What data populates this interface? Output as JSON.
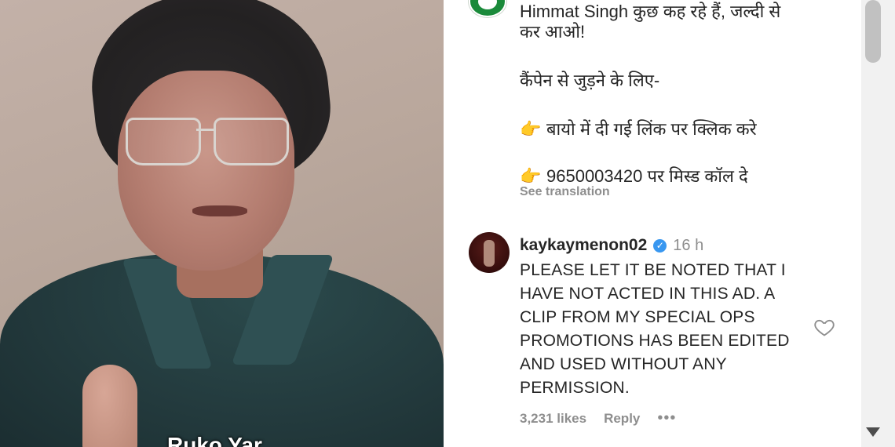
{
  "video": {
    "caption": "Ruko Yar"
  },
  "post": {
    "hindi_line1": "Himmat Singh कुछ कह रहे हैं, जल्दी से",
    "hindi_line2": "कर आओ!",
    "hindi_line3": "कैंपेन से जुड़ने के लिए-",
    "bullet1": "बायो में दी गई लिंक पर क्लिक करे",
    "bullet2": "9650003420 पर मिस्ड कॉल दे",
    "see_translation": "See translation"
  },
  "comment": {
    "username": "kaykaymenon02",
    "time": "16 h",
    "body": "PLEASE LET IT BE NOTED THAT I HAVE NOT ACTED IN THIS AD. A CLIP FROM MY SPECIAL OPS PROMOTIONS HAS BEEN EDITED AND USED WITHOUT ANY PERMISSION.",
    "likes": "3,231 likes",
    "reply": "Reply",
    "more": "•••"
  },
  "icons": {
    "pointing_hand": "👉",
    "verified": "✓"
  },
  "colors": {
    "text": "#262626",
    "muted": "#8e8e8e",
    "verified": "#3897f0",
    "shirt": "#233a3d"
  }
}
